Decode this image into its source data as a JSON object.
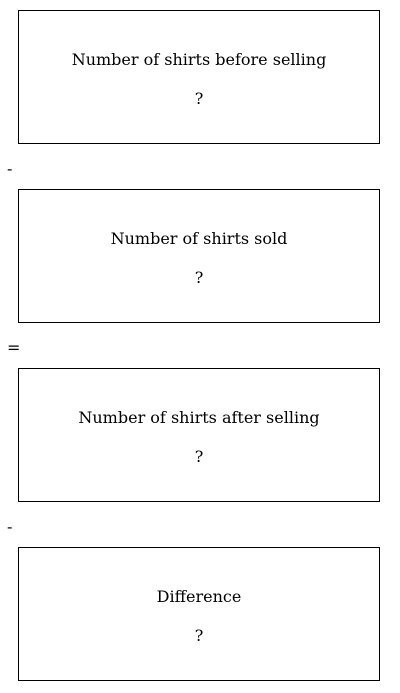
{
  "boxes": [
    {
      "label": "Number of shirts before selling",
      "value": "?"
    },
    {
      "label": "Number of shirts sold",
      "value": "?"
    },
    {
      "label": "Number of shirts after selling",
      "value": "?"
    },
    {
      "label": "Difference",
      "value": "?"
    }
  ],
  "operators": [
    "-",
    "=",
    "-"
  ]
}
